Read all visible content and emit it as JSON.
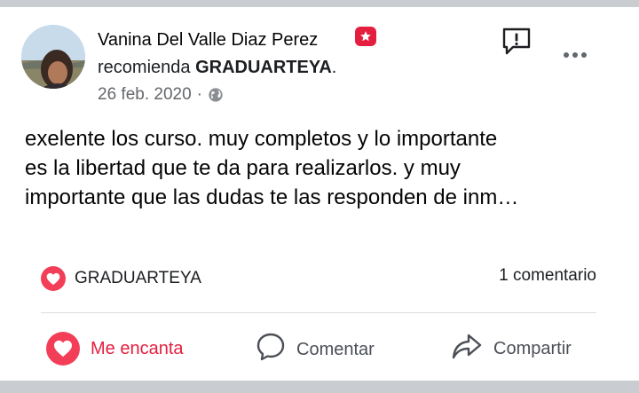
{
  "post": {
    "author": "Vanina Del Valle Diaz Perez",
    "recommend_prefix": "recomienda ",
    "page_name": "GRADUARTEYA",
    "recommend_suffix": ".",
    "date": "26 feb. 2020",
    "date_separator": "·",
    "text_lines": [
      "exelente los curso. muy completos y lo importante",
      "es la libertad que te da para realizarlos. y muy",
      "importante que las dudas te las responden de inm…"
    ]
  },
  "reactions": {
    "label": "GRADUARTEYA",
    "comments": "1 comentario"
  },
  "actions": {
    "love": "Me encanta",
    "comment": "Comentar",
    "share": "Compartir"
  },
  "icons": {
    "badge": "recommendation-star-icon",
    "privacy": "globe-icon",
    "report": "report-icon",
    "more": "more-dots-icon",
    "reaction": "heart-reaction-icon",
    "love": "heart-icon",
    "comment": "comment-bubble-icon",
    "share": "share-arrow-icon"
  },
  "colors": {
    "love_red": "#e41e3f",
    "reaction_heart": "#f33e58",
    "secondary_text": "#65676b",
    "divider": "#dadde1"
  }
}
